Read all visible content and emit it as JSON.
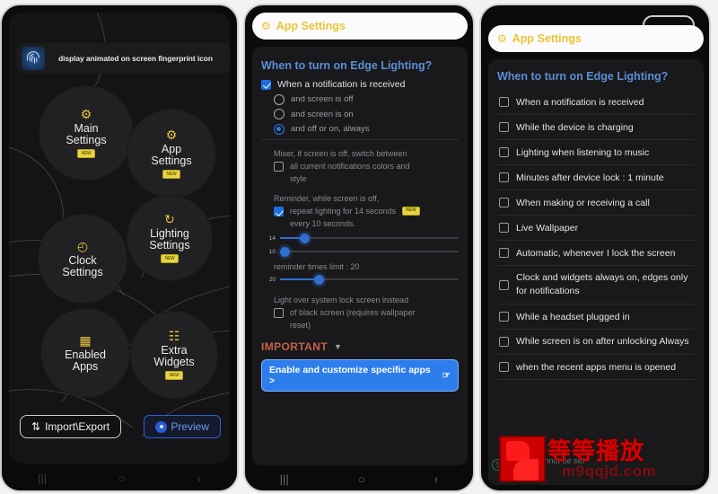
{
  "panel1": {
    "fingerprint_bar": {
      "icon": "fingerprint-icon",
      "text": "display animated on screen fingerprint icon"
    },
    "menu_items": [
      {
        "label_line1": "Main",
        "label_line2": "Settings",
        "icon": "gear-icon",
        "badge": "NEW"
      },
      {
        "label_line1": "App",
        "label_line2": "Settings",
        "icon": "gear-icon",
        "badge": "NEW"
      },
      {
        "label_line1": "Lighting",
        "label_line2": "Settings",
        "icon": "refresh-icon",
        "badge": "NEW"
      },
      {
        "label_line1": "Clock",
        "label_line2": "Settings",
        "icon": "clock-icon",
        "badge": ""
      },
      {
        "label_line1": "Enabled",
        "label_line2": "Apps",
        "icon": "grid-icon",
        "badge": ""
      },
      {
        "label_line1": "Extra",
        "label_line2": "Widgets",
        "icon": "widgets-icon",
        "badge": "NEW"
      }
    ],
    "import_export_label": "Import\\Export",
    "preview_label": "Preview"
  },
  "panel2": {
    "appbar_title": "App Settings",
    "section_title": "When to turn on Edge Lighting?",
    "main_checkbox": {
      "label": "When a notification is received",
      "checked": true
    },
    "radios": [
      {
        "label": "and screen is off",
        "selected": false
      },
      {
        "label": "and screen is on",
        "selected": false
      },
      {
        "label": "and off or on, always",
        "selected": true
      }
    ],
    "mixer": {
      "note_line1": "Mixer, if screen is off, switch between",
      "note_line2": "all current notifications colors and",
      "note_line3": "style",
      "checked": false
    },
    "reminder": {
      "note_line1": "Reminder, while screen is off,",
      "note_line2": "repeat lighting for  14 seconds",
      "note_line3": "every 10 seconds.",
      "checked": true,
      "badge": "NEW"
    },
    "sliders": [
      {
        "value_label": "14",
        "percent": 14
      },
      {
        "value_label": "10",
        "percent": 3
      },
      {
        "value_label": "20",
        "percent": 22
      }
    ],
    "limit_label": "reminder times limit : 20",
    "lockscreen": {
      "note_line1": "Light over system lock screen instead",
      "note_line2": "of black screen (requires wallpaper",
      "note_line3": "reset)",
      "checked": false
    },
    "important_label": "IMPORTANT",
    "important_chevron": "chevron-down-icon",
    "cta_label": "Enable and customize specific apps >",
    "cta_icon": "pointer-hand-icon"
  },
  "panel3": {
    "appbar_title": "App Settings",
    "section_title": "When to turn on Edge Lighting?",
    "items": [
      {
        "label": "When a notification is received",
        "checked": false,
        "two_line": false
      },
      {
        "label": "While the device is charging",
        "checked": false,
        "two_line": false
      },
      {
        "label": "Lighting when listening to music",
        "checked": false,
        "two_line": false
      },
      {
        "label": "Minutes after device lock : 1 minute",
        "checked": false,
        "two_line": false
      },
      {
        "label": "When making or receiving a call",
        "checked": false,
        "two_line": false
      },
      {
        "label": "Live Wallpaper",
        "checked": false,
        "two_line": false
      },
      {
        "label": "Automatic, whenever I lock the screen",
        "checked": false,
        "two_line": false
      },
      {
        "label": "Clock and widgets always on, edges only for notifications",
        "checked": false,
        "two_line": true
      },
      {
        "label": "While a headset plugged in",
        "checked": false,
        "two_line": false
      },
      {
        "label": "While screen is on after unlocking Always",
        "checked": false,
        "two_line": true
      },
      {
        "label": "when the recent apps menu is opened",
        "checked": false,
        "two_line": false
      }
    ],
    "obscured_row": "triggers, cannot be set",
    "watermark": {
      "cn_text": "等等播放",
      "url": "m9qqjd.com"
    }
  },
  "colors": {
    "accent_blue": "#2e7ded",
    "accent_yellow": "#e8c53a",
    "section_blue": "#5b8ed6",
    "important_red": "#c4604a",
    "badge_yellow": "#e8d44a"
  },
  "navbar": {
    "recents": "|||",
    "home": "○",
    "back": "‹"
  }
}
